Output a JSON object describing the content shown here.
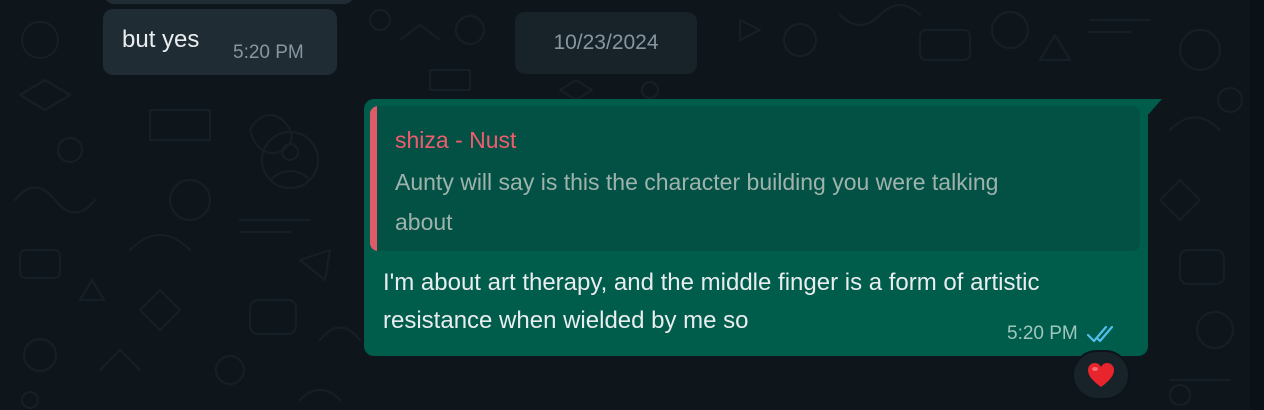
{
  "incoming_message": {
    "text": "but yes",
    "time": "5:20 PM"
  },
  "date_separator": "10/23/2024",
  "outgoing_message": {
    "quoted": {
      "author": "shiza - Nust",
      "text": "Aunty will say is this the character building you were talking about"
    },
    "text": "I'm about art therapy, and the middle finger is a form of artistic resistance when wielded by me so",
    "time": "5:20 PM",
    "status_icon": "double-check-read-icon",
    "reaction": "heart-emoji"
  },
  "colors": {
    "background": "#0b141a",
    "incoming_bubble": "#202c33",
    "outgoing_bubble": "#005c4b",
    "quote_author": "#f15c6d",
    "read_ticks": "#53bdeb",
    "reaction_heart": "#e8252d"
  }
}
